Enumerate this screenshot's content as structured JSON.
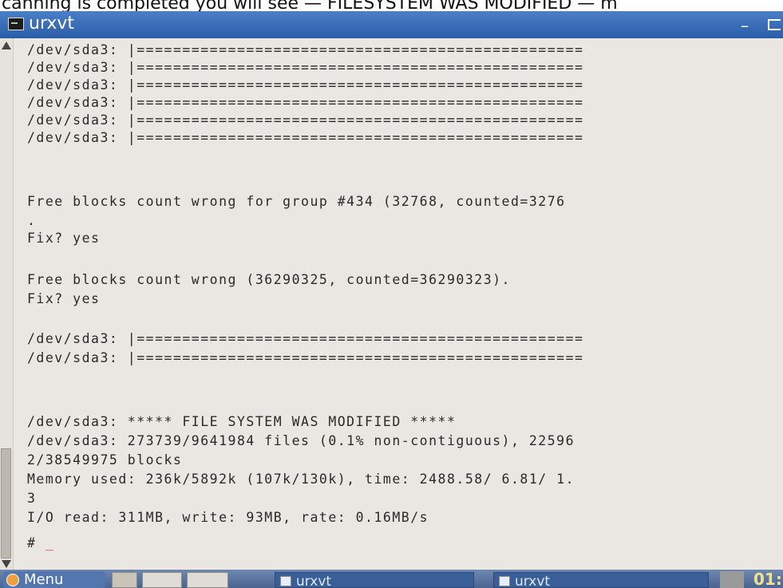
{
  "caption": "canning is completed you will see — FILESYSTEM WAS MODIFIED — m",
  "window": {
    "title": "urxvt"
  },
  "terminal": {
    "lines": [
      "/dev/sda3: |=================================================",
      "/dev/sda3: |=================================================",
      "/dev/sda3: |=================================================",
      "/dev/sda3: |=================================================",
      "/dev/sda3: |=================================================",
      "/dev/sda3: |=================================================",
      "Free blocks count wrong for group #434 (32768, counted=3276",
      ".",
      "Fix? yes",
      "Free blocks count wrong (36290325, counted=36290323).",
      "Fix? yes",
      "/dev/sda3: |=================================================",
      "/dev/sda3: |=================================================",
      "/dev/sda3: ***** FILE SYSTEM WAS MODIFIED *****",
      "/dev/sda3: 273739/9641984 files (0.1% non-contiguous), 22596",
      "2/38549975 blocks",
      "Memory used: 236k/5892k (107k/130k), time: 2488.58/ 6.81/ 1.",
      "3",
      "I/O read: 311MB, write: 93MB, rate: 0.16MB/s",
      "# "
    ],
    "cursor": "_"
  },
  "taskbar": {
    "menu_label": "Menu",
    "tasks": [
      "urxvt",
      "urxvt"
    ],
    "clock": "01:"
  }
}
